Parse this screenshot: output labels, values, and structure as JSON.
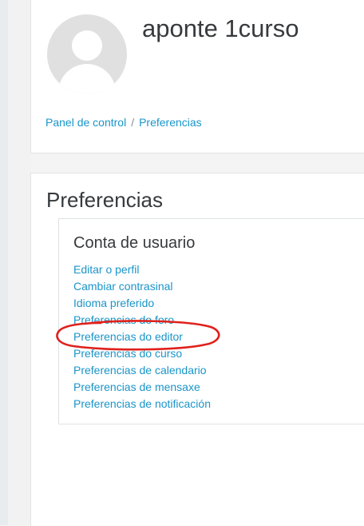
{
  "header": {
    "user_name": "aponte 1curso",
    "breadcrumb": [
      "Panel de control",
      "Preferencias"
    ]
  },
  "main": {
    "page_title": "Preferencias",
    "section": {
      "title": "Conta de usuario",
      "links": [
        "Editar o perfil",
        "Cambiar contrasinal",
        "Idioma preferido",
        "Preferencias do foro",
        "Preferencias do editor",
        "Preferencias do curso",
        "Preferencias de calendario",
        "Preferencias de mensaxe",
        "Preferencias de notificación"
      ]
    }
  },
  "colors": {
    "link": "#1a95c9",
    "heading": "#373a3c",
    "annotation": "#e0201b",
    "page_background": "#f4f4f4"
  }
}
